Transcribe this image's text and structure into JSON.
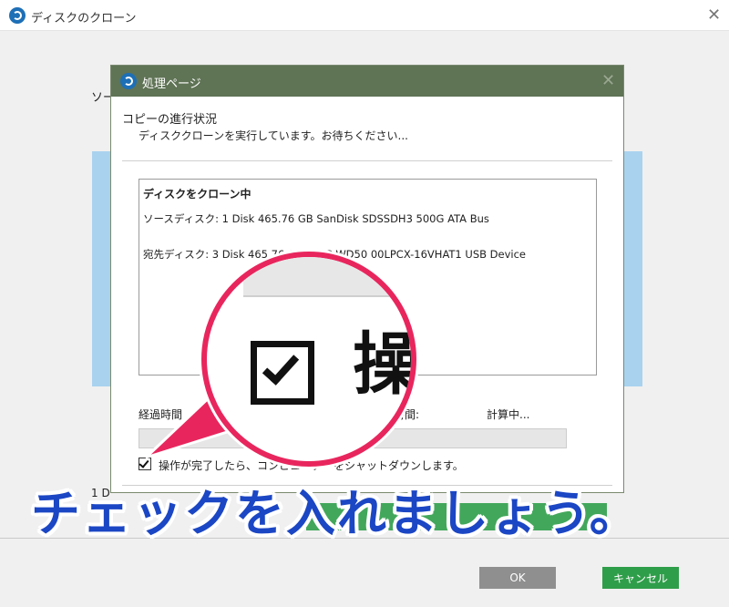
{
  "back_window": {
    "title": "ディスクのクローン",
    "fragment_source": "ソー",
    "fragment_disk": "1 D",
    "ok_label": "OK",
    "cancel_label": "キャンセル"
  },
  "dialog": {
    "title": "処理ページ",
    "heading": "コピーの進行状況",
    "subheading": "ディスククローンを実行しています。お待ちください...",
    "panel": {
      "title": "ディスクをクローン中",
      "source": "ソースディスク: 1 Disk 465.76 GB SanDisk SDSSDH3 500G ATA Bus",
      "destination": "宛先ディスク: 3 Disk 465.76 GB WDC WD50 00LPCX-16VHAT1 USB Device"
    },
    "elapsed_label": "経過時間",
    "remaining_label": "時間:",
    "remaining_value": "計算中...",
    "progress_fraction": 0,
    "shutdown_checkbox": {
      "checked": true,
      "label": "操作が完了したら、コンピューターをシャットダウンします。"
    }
  },
  "magnifier": {
    "glyph": "操"
  },
  "caption": "チェックを入れましょう。",
  "colors": {
    "dialog_titlebar": "#5f7355",
    "callout_pink": "#e8265d",
    "caption_blue": "#1b46c4",
    "cancel_green": "#2f9e4a",
    "ok_gray": "#8f8f8f",
    "accent_blue": "#a9d2ef"
  }
}
